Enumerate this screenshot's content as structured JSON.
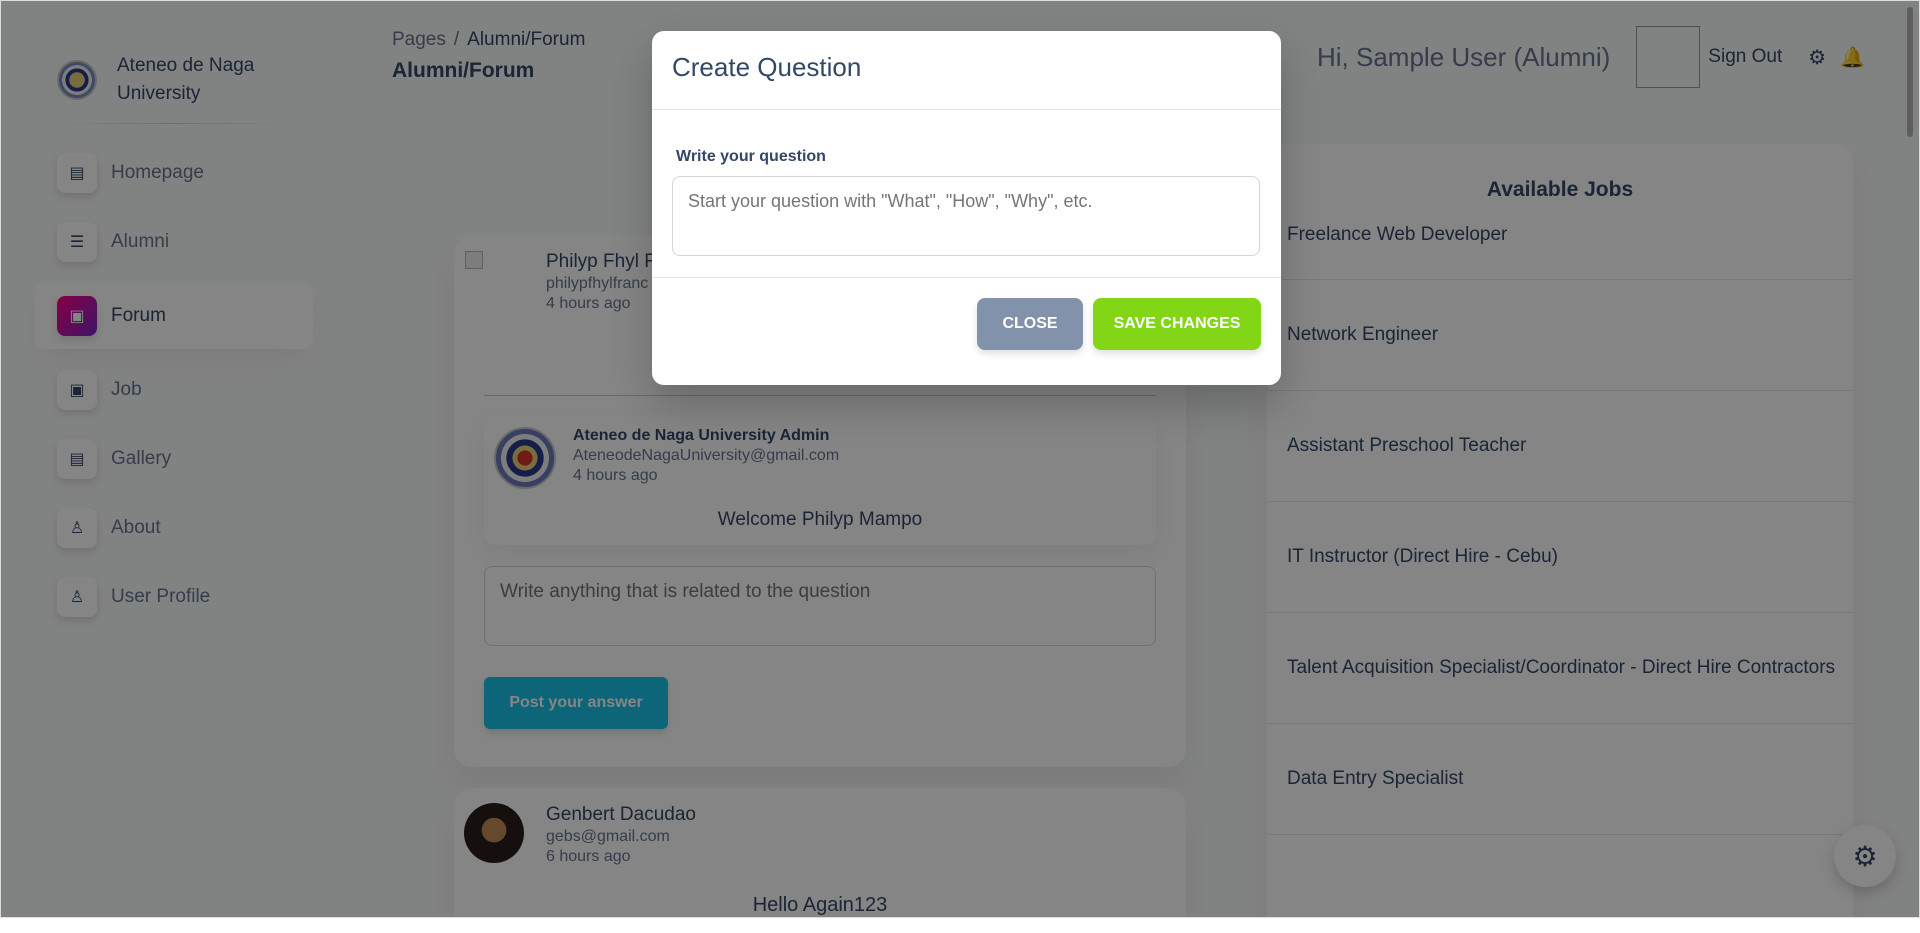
{
  "sidebar": {
    "brand": "Ateneo de Naga University",
    "items": [
      {
        "label": "Homepage",
        "icon": "document-icon"
      },
      {
        "label": "Alumni",
        "icon": "list-icon"
      },
      {
        "label": "Forum",
        "icon": "card-icon",
        "active": true
      },
      {
        "label": "Job",
        "icon": "card-icon"
      },
      {
        "label": "Gallery",
        "icon": "document-icon"
      },
      {
        "label": "About",
        "icon": "user-card-icon"
      },
      {
        "label": "User Profile",
        "icon": "user-card-icon"
      }
    ]
  },
  "header": {
    "breadcrumb_root": "Pages",
    "breadcrumb_sep": "/",
    "breadcrumb_current": "Alumni/Forum",
    "title": "Alumni/Forum",
    "greeting": "Hi, Sample User (Alumni)",
    "signout": "Sign Out"
  },
  "feed": {
    "question": {
      "author": "Philyp Fhyl F",
      "email": "philypfhylfranc",
      "time": "4 hours ago",
      "reply": {
        "author": "Ateneo de Naga University Admin",
        "email": "AteneodeNagaUniversity@gmail.com",
        "time": "4 hours ago",
        "text": "Welcome Philyp Mampo"
      },
      "answer_placeholder": "Write anything that is related to the question",
      "post_label": "Post your answer"
    },
    "second": {
      "author": "Genbert Dacudao",
      "email": "gebs@gmail.com",
      "time": "6 hours ago",
      "text": "Hello Again123"
    }
  },
  "jobs": {
    "title": "Available Jobs",
    "items": [
      "Freelance Web Developer",
      "Network Engineer",
      "Assistant Preschool Teacher",
      "IT Instructor (Direct Hire - Cebu)",
      "Talent Acquisition Specialist/Coordinator - Direct Hire Contractors",
      "Data Entry Specialist"
    ]
  },
  "modal": {
    "title": "Create Question",
    "field_label": "Write your question",
    "placeholder": "Start your question with \"What\", \"How\", \"Why\", etc.",
    "close_label": "CLOSE",
    "save_label": "SAVE CHANGES"
  },
  "colors": {
    "primary_text": "#344767",
    "secondary_text": "#67748e",
    "info": "#17c1e8",
    "success": "#82d616",
    "secondary_btn": "#8392ab",
    "active_icon_gradient": [
      "#7928ca",
      "#ff0080"
    ]
  }
}
